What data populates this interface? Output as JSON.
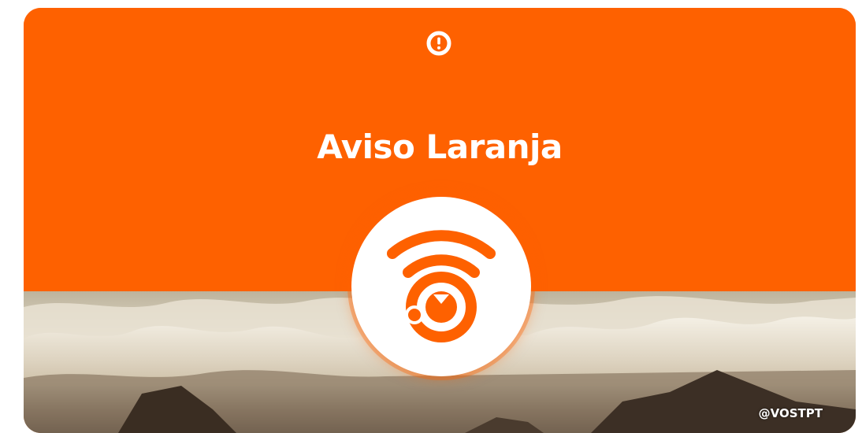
{
  "card": {
    "title": "Aviso Laranja",
    "watermark": "@VOSTPT",
    "accent_color": "#fe6100",
    "top_icon": "alert-circle-icon",
    "badge_icon": "wave-signal-icon",
    "background": "sea-waves-on-rocks-photo"
  }
}
